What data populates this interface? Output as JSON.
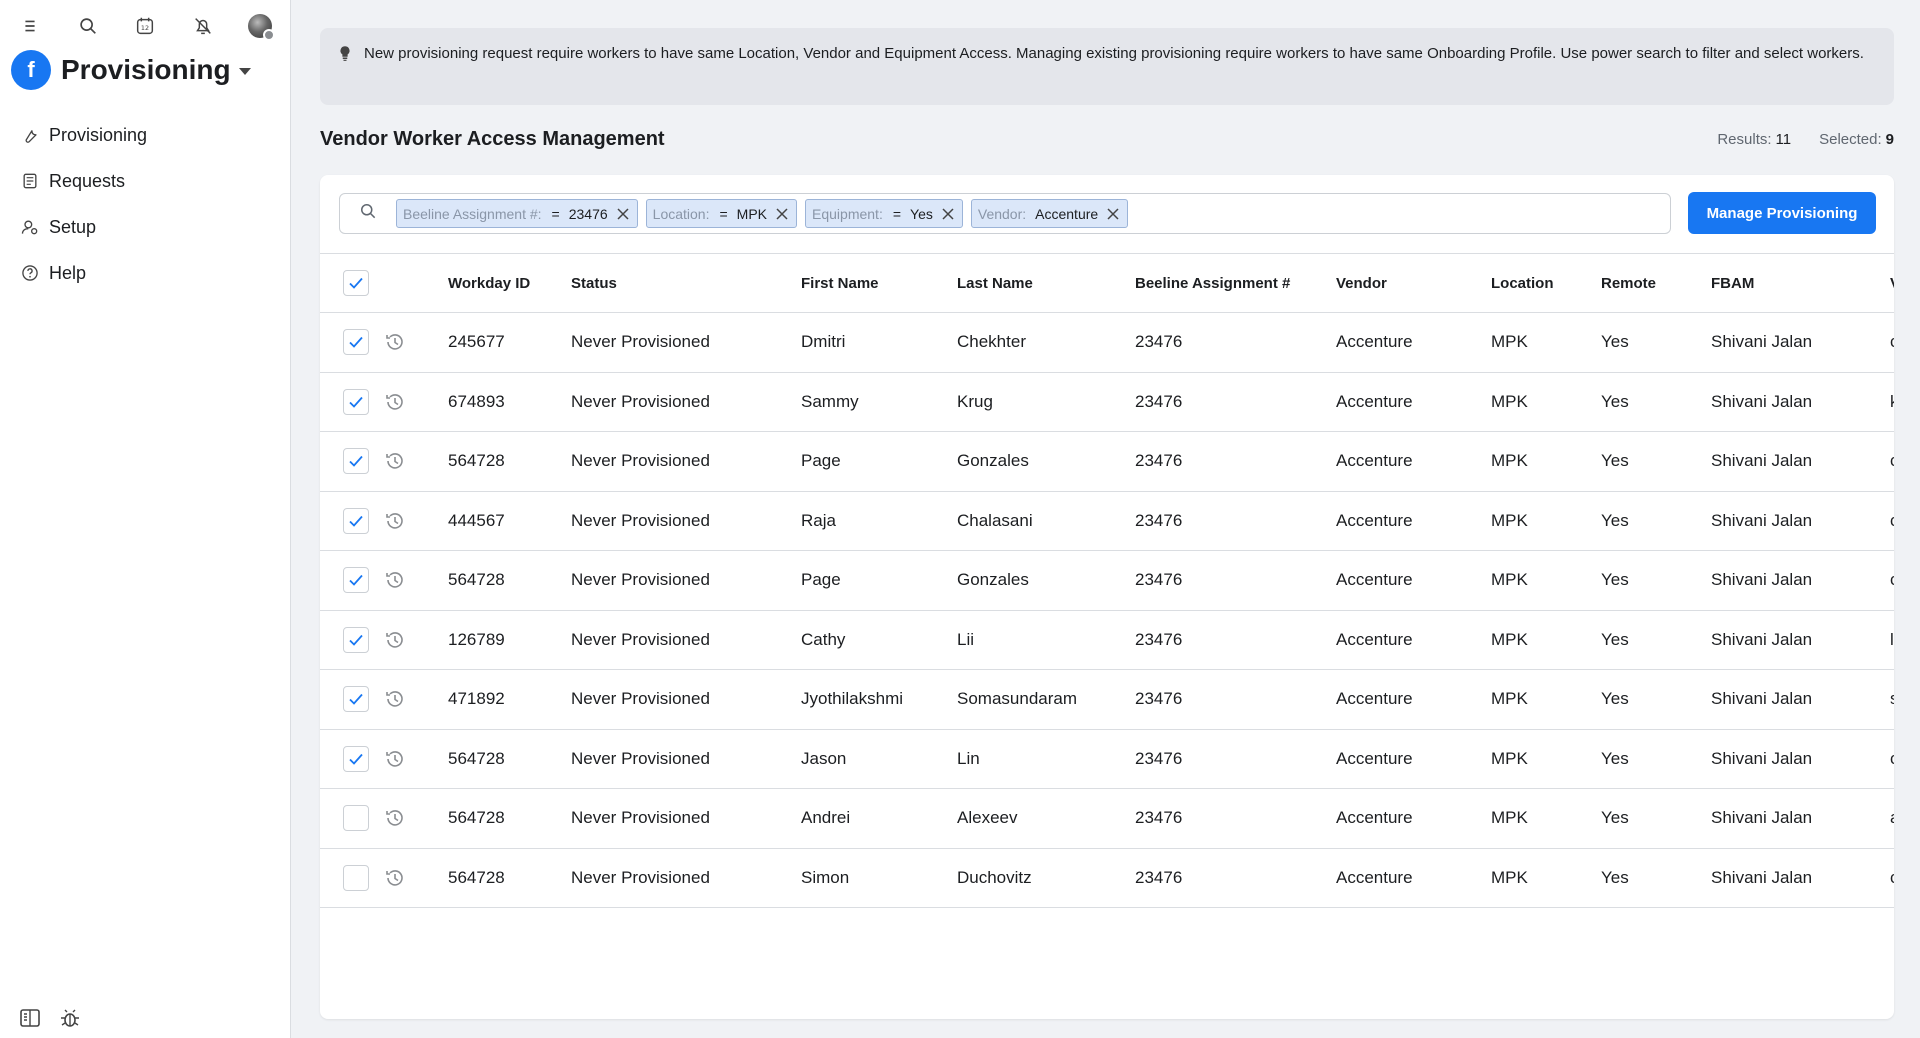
{
  "sidebar": {
    "brand_logo": "f",
    "brand_title": "Provisioning",
    "nav": [
      {
        "label": "Provisioning",
        "icon": "wrench-icon"
      },
      {
        "label": "Requests",
        "icon": "requests-icon"
      },
      {
        "label": "Setup",
        "icon": "setup-icon"
      },
      {
        "label": "Help",
        "icon": "help-icon"
      }
    ]
  },
  "banner": {
    "text": "New provisioning request require workers to have same Location, Vendor and Equipment Access. Managing existing provisioning require workers to have same Onboarding Profile. Use power search to filter and select workers."
  },
  "page": {
    "title": "Vendor Worker Access Management",
    "results_label": "Results:",
    "results_value": "11",
    "selected_label": "Selected:",
    "selected_value": "9"
  },
  "filters": [
    {
      "key": "Beeline Assignment #:",
      "op": "=",
      "value": "23476"
    },
    {
      "key": "Location:",
      "op": "=",
      "value": "MPK"
    },
    {
      "key": "Equipment:",
      "op": "=",
      "value": "Yes"
    },
    {
      "key": "Vendor:",
      "op": "",
      "value": "Accenture"
    }
  ],
  "manage_button": "Manage Provisioning",
  "table": {
    "header_all_checked": true,
    "columns": [
      "Workday ID",
      "Status",
      "First Name",
      "Last Name",
      "Beeline Assignment #",
      "Vendor",
      "Location",
      "Remote",
      "FBAM",
      "V"
    ],
    "rows": [
      {
        "checked": true,
        "id": "245677",
        "status": "Never Provisioned",
        "first": "Dmitri",
        "last": "Chekhter",
        "beeline": "23476",
        "vendor": "Accenture",
        "location": "MPK",
        "remote": "Yes",
        "fbam": "Shivani Jalan",
        "cut": "c"
      },
      {
        "checked": true,
        "id": "674893",
        "status": "Never Provisioned",
        "first": "Sammy",
        "last": "Krug",
        "beeline": "23476",
        "vendor": "Accenture",
        "location": "MPK",
        "remote": "Yes",
        "fbam": "Shivani Jalan",
        "cut": "k"
      },
      {
        "checked": true,
        "id": "564728",
        "status": "Never Provisioned",
        "first": "Page",
        "last": "Gonzales",
        "beeline": "23476",
        "vendor": "Accenture",
        "location": "MPK",
        "remote": "Yes",
        "fbam": "Shivani Jalan",
        "cut": "c"
      },
      {
        "checked": true,
        "id": "444567",
        "status": "Never Provisioned",
        "first": "Raja",
        "last": "Chalasani",
        "beeline": "23476",
        "vendor": "Accenture",
        "location": "MPK",
        "remote": "Yes",
        "fbam": "Shivani Jalan",
        "cut": "c"
      },
      {
        "checked": true,
        "id": "564728",
        "status": "Never Provisioned",
        "first": "Page",
        "last": "Gonzales",
        "beeline": "23476",
        "vendor": "Accenture",
        "location": "MPK",
        "remote": "Yes",
        "fbam": "Shivani Jalan",
        "cut": "c"
      },
      {
        "checked": true,
        "id": "126789",
        "status": "Never Provisioned",
        "first": "Cathy",
        "last": "Lii",
        "beeline": "23476",
        "vendor": "Accenture",
        "location": "MPK",
        "remote": "Yes",
        "fbam": "Shivani Jalan",
        "cut": "l"
      },
      {
        "checked": true,
        "id": "471892",
        "status": "Never Provisioned",
        "first": "Jyothilakshmi",
        "last": "Somasundaram",
        "beeline": "23476",
        "vendor": "Accenture",
        "location": "MPK",
        "remote": "Yes",
        "fbam": "Shivani Jalan",
        "cut": "s"
      },
      {
        "checked": true,
        "id": "564728",
        "status": "Never Provisioned",
        "first": "Jason",
        "last": "Lin",
        "beeline": "23476",
        "vendor": "Accenture",
        "location": "MPK",
        "remote": "Yes",
        "fbam": "Shivani Jalan",
        "cut": "c"
      },
      {
        "checked": false,
        "id": "564728",
        "status": "Never Provisioned",
        "first": "Andrei",
        "last": "Alexeev",
        "beeline": "23476",
        "vendor": "Accenture",
        "location": "MPK",
        "remote": "Yes",
        "fbam": "Shivani Jalan",
        "cut": "a"
      },
      {
        "checked": false,
        "id": "564728",
        "status": "Never Provisioned",
        "first": "Simon",
        "last": "Duchovitz",
        "beeline": "23476",
        "vendor": "Accenture",
        "location": "MPK",
        "remote": "Yes",
        "fbam": "Shivani Jalan",
        "cut": "c"
      }
    ]
  },
  "colors": {
    "accent": "#1877f2",
    "chip_bg": "#dbe7f9",
    "banner_bg": "#e4e6eb"
  }
}
